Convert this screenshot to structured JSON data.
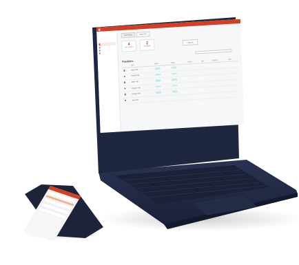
{
  "laptop_app": {
    "tabs": [
      "All Positions",
      "Open Jobs"
    ],
    "cards": [
      {
        "value": "4",
        "label": "Open positions"
      },
      {
        "value": "2",
        "label": "Candidates"
      }
    ],
    "add_button": "+ Add Job",
    "section_title": "Positions",
    "table_headers": [
      "",
      "Name",
      "Status",
      "Status",
      "Added",
      "Date",
      "Updated",
      "Date"
    ],
    "rows": [
      {
        "name": "Admin Title"
      },
      {
        "name": "Position Title"
      },
      {
        "name": "Medic Title"
      },
      {
        "name": "Designer Title"
      },
      {
        "name": "Manager Title"
      },
      {
        "name": "Store Title"
      }
    ]
  },
  "colors": {
    "accent": "#d63d22",
    "laptop_body": "#1f2943",
    "background": "#ffffff"
  }
}
